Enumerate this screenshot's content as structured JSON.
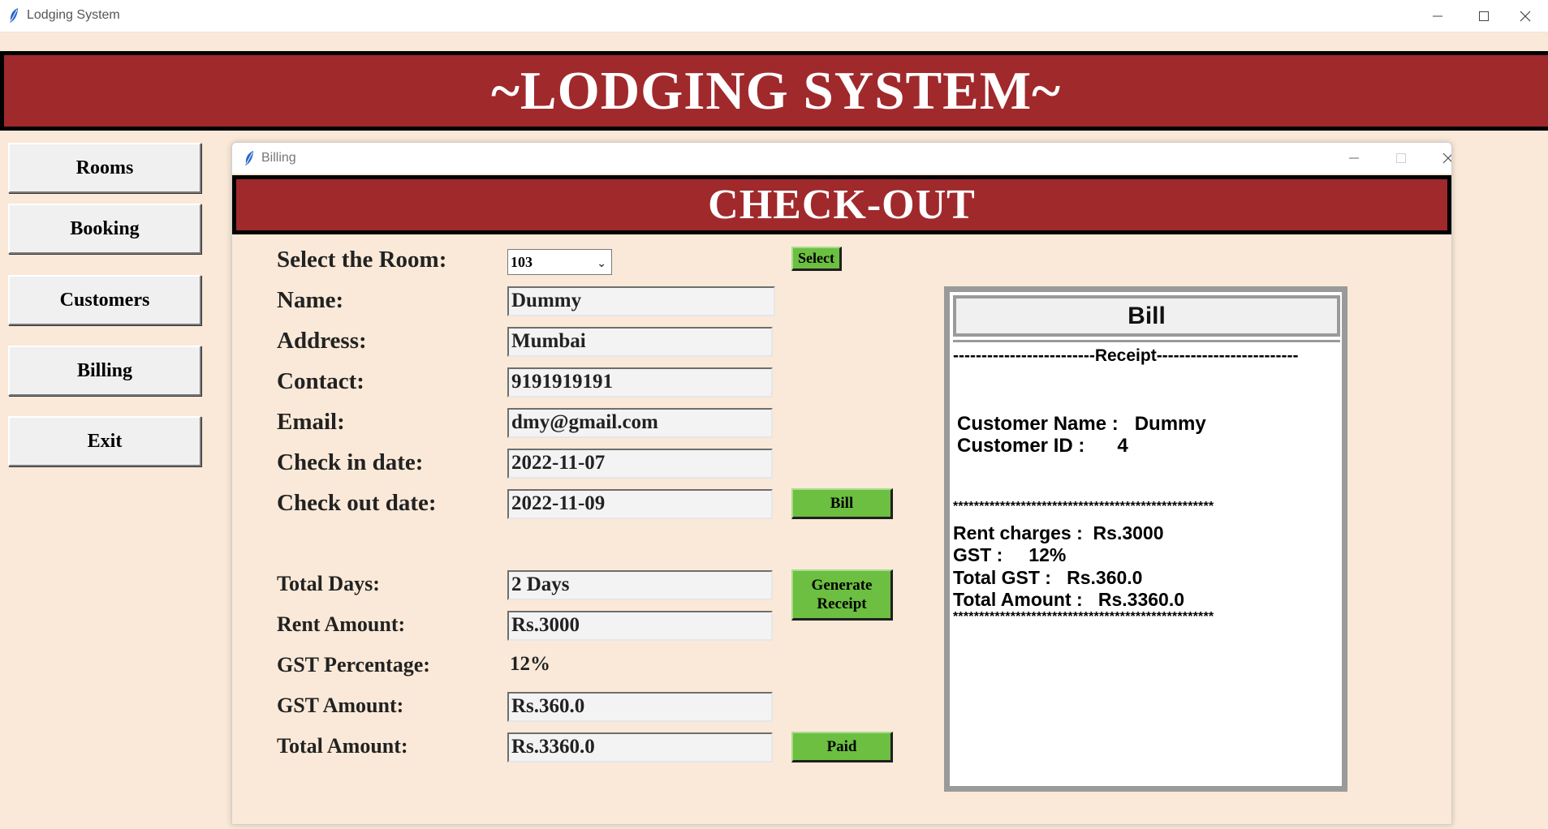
{
  "app": {
    "title": "Lodging System",
    "banner": "~LODGING SYSTEM~"
  },
  "window_controls": {
    "minimize": "—",
    "maximize": "☐",
    "close": "✕"
  },
  "nav": [
    {
      "label": "Rooms"
    },
    {
      "label": "Booking"
    },
    {
      "label": "Customers"
    },
    {
      "label": "Billing"
    },
    {
      "label": "Exit"
    }
  ],
  "billing": {
    "window_title": "Billing",
    "banner": "CHECK-OUT",
    "room": {
      "label": "Select the Room:",
      "value": "103"
    },
    "select_button": "Select",
    "fields": {
      "name": {
        "label": "Name:",
        "value": "Dummy"
      },
      "address": {
        "label": "Address:",
        "value": "Mumbai"
      },
      "contact": {
        "label": "Contact:",
        "value": "9191919191"
      },
      "email": {
        "label": "Email:",
        "value": "dmy@gmail.com"
      },
      "checkin": {
        "label": "Check in date:",
        "value": "2022-11-07"
      },
      "checkout": {
        "label": "Check out date:",
        "value": "2022-11-09"
      },
      "total_days": {
        "label": "Total Days:",
        "value": "2 Days"
      },
      "rent_amount": {
        "label": "Rent Amount:",
        "value": "Rs.3000"
      },
      "gst_percentage": {
        "label": "GST Percentage:",
        "value": "12%"
      },
      "gst_amount": {
        "label": "GST Amount:",
        "value": "Rs.360.0"
      },
      "total_amount": {
        "label": "Total Amount:",
        "value": "Rs.3360.0"
      }
    },
    "bill_button": "Bill",
    "receipt_button_line1": "Generate",
    "receipt_button_line2": "Receipt",
    "paid_button": "Paid"
  },
  "bill": {
    "header": "Bill",
    "receipt_line": "-------------------------Receipt-------------------------",
    "customer_name": "Customer Name :   Dummy",
    "customer_id": "Customer ID :      4",
    "stars": "**************************************************",
    "rent_charges": "Rent charges :  Rs.3000",
    "gst": "GST :     12%",
    "total_gst": "Total GST :   Rs.360.0",
    "total_amount": "Total Amount :   Rs.3360.0",
    "stars_bottom": "**************************************************"
  },
  "colors": {
    "banner": "#a0292c",
    "background": "#fae9d8",
    "button_green": "#6cbf41"
  },
  "icons": [
    "feather-icon",
    "minimize-icon",
    "maximize-icon",
    "close-icon",
    "chevron-down-icon"
  ]
}
